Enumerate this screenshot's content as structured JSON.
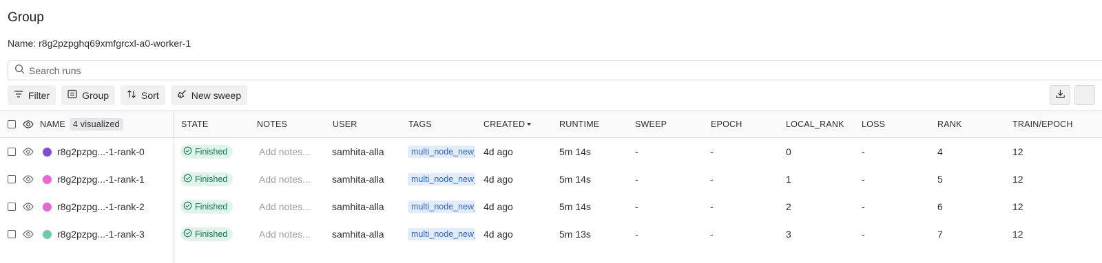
{
  "page": {
    "title": "Group",
    "name_line": "Name: r8g2pzpghq69xmfgrcxl-a0-worker-1"
  },
  "search": {
    "placeholder": "Search runs"
  },
  "toolbar": {
    "filter": "Filter",
    "group": "Group",
    "sort": "Sort",
    "new_sweep": "New sweep"
  },
  "table": {
    "headers": {
      "name": "NAME",
      "visualized": "4 visualized",
      "state": "STATE",
      "notes": "NOTES",
      "user": "USER",
      "tags": "TAGS",
      "created": "CREATED",
      "runtime": "RUNTIME",
      "sweep": "SWEEP",
      "epoch": "EPOCH",
      "local_rank": "LOCAL_RANK",
      "loss": "LOSS",
      "rank": "RANK",
      "train_epoch": "TRAIN/EPOCH"
    },
    "rows": [
      {
        "color": "#7e4fd6",
        "name": "r8g2pzpg...-1-rank-0",
        "state": "Finished",
        "notes": "Add notes...",
        "user": "samhita-alla",
        "tag": "multi_node_new_",
        "created": "4d ago",
        "runtime": "5m 14s",
        "sweep": "-",
        "epoch": "-",
        "local_rank": "0",
        "loss": "-",
        "rank": "4",
        "train_epoch": "12"
      },
      {
        "color": "#e866d6",
        "name": "r8g2pzpg...-1-rank-1",
        "state": "Finished",
        "notes": "Add notes...",
        "user": "samhita-alla",
        "tag": "multi_node_new_",
        "created": "4d ago",
        "runtime": "5m 14s",
        "sweep": "-",
        "epoch": "-",
        "local_rank": "1",
        "loss": "-",
        "rank": "5",
        "train_epoch": "12"
      },
      {
        "color": "#e866d6",
        "name": "r8g2pzpg...-1-rank-2",
        "state": "Finished",
        "notes": "Add notes...",
        "user": "samhita-alla",
        "tag": "multi_node_new_",
        "created": "4d ago",
        "runtime": "5m 14s",
        "sweep": "-",
        "epoch": "-",
        "local_rank": "2",
        "loss": "-",
        "rank": "6",
        "train_epoch": "12"
      },
      {
        "color": "#6cc9b2",
        "name": "r8g2pzpg...-1-rank-3",
        "state": "Finished",
        "notes": "Add notes...",
        "user": "samhita-alla",
        "tag": "multi_node_new_",
        "created": "4d ago",
        "runtime": "5m 13s",
        "sweep": "-",
        "epoch": "-",
        "local_rank": "3",
        "loss": "-",
        "rank": "7",
        "train_epoch": "12"
      }
    ]
  }
}
